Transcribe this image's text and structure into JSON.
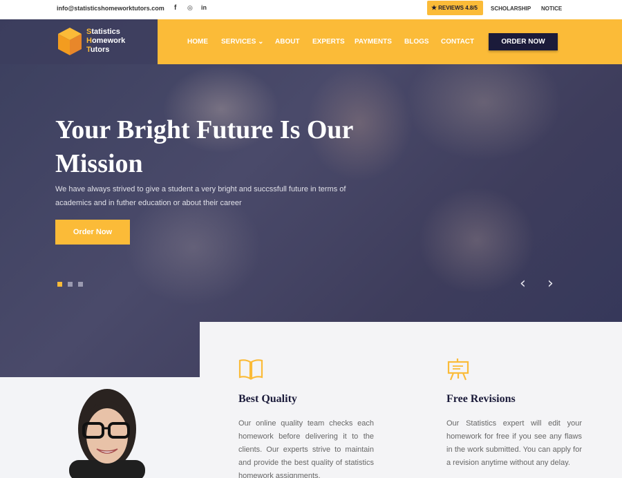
{
  "topbar": {
    "email": "info@statisticshomeworktutors.com",
    "social": {
      "facebook": "f",
      "instagram": "◎",
      "linkedin": "in"
    },
    "reviews_label": "REVIEWS 4.8/5",
    "links": [
      "SCHOLARSHIP",
      "NOTICE"
    ]
  },
  "logo": {
    "line1_cap": "S",
    "line1_rest": "tatistics",
    "line2_cap": "H",
    "line2_rest": "omework",
    "line3_cap": "T",
    "line3_rest": "utors"
  },
  "nav": {
    "items": [
      "HOME",
      "SERVICES",
      "ABOUT",
      "EXPERTS",
      "PAYMENTS",
      "BLOGS",
      "CONTACT"
    ],
    "services_chevron": "⌄",
    "order_button": "ORDER NOW"
  },
  "hero": {
    "title": "Your Bright Future Is Our Mission",
    "subtitle": "We have always strived to give a student a very bright and succssfull future in terms of academics and in futher education or about their career",
    "button": "Order Now",
    "prev_arrow": "‹",
    "next_arrow": "›"
  },
  "features": [
    {
      "icon": "book-icon",
      "title": "Best Quality",
      "description": "Our online quality team checks each homework before delivering it to the clients. Our experts strive to maintain and provide the best quality of statistics homework assignments."
    },
    {
      "icon": "easel-icon",
      "title": "Free Revisions",
      "description": "Our Statistics expert will edit your homework for free if you see any flaws in the work submitted. You can apply for a revision anytime without any delay."
    }
  ],
  "colors": {
    "accent": "#fbbb38",
    "navy": "#1b1b3a",
    "hero_overlay": "#3e3d5c"
  }
}
